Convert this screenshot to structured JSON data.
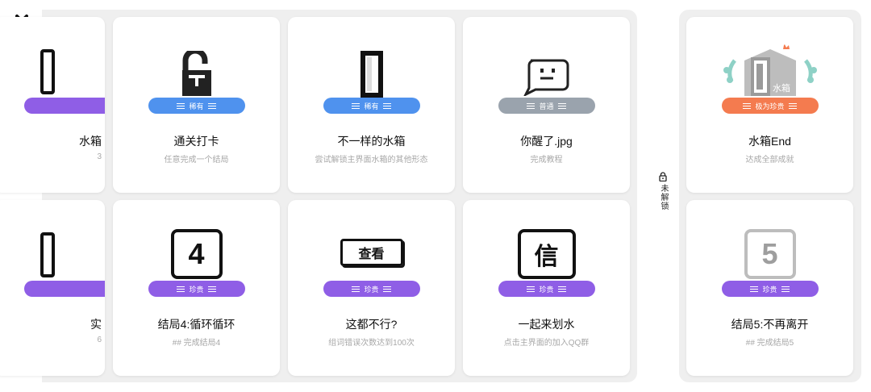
{
  "close_icon": "close-icon",
  "locked_section": {
    "label": "未解锁",
    "icon": "lock-icon"
  },
  "cards": {
    "r1c0": {
      "title": "水箱",
      "desc": "3",
      "badge": ""
    },
    "r1c1": {
      "title": "通关打卡",
      "desc": "任意完成一个结局",
      "badge": "稀有",
      "tier": "rare"
    },
    "r1c2": {
      "title": "不一样的水箱",
      "desc": "尝试解锁主界面水箱的其他形态",
      "badge": "稀有",
      "tier": "rare"
    },
    "r1c3": {
      "title": "你醒了.jpg",
      "desc": "完成教程",
      "badge": "普通",
      "tier": "common"
    },
    "r1side": {
      "title": "水箱End",
      "desc": "达成全部成就",
      "badge": "极为珍贵",
      "tier": "ultra"
    },
    "r2c0": {
      "title": "实",
      "desc": "6",
      "badge": ""
    },
    "r2c1": {
      "title": "结局4:循环循环",
      "desc": "## 完成结局4",
      "badge": "珍贵",
      "tier": "precious"
    },
    "r2c2": {
      "title": "这都不行?",
      "desc": "组词错误次数达到100次",
      "badge": "珍贵",
      "tier": "precious",
      "icon_text": "查看"
    },
    "r2c3": {
      "title": "一起来划水",
      "desc": "点击主界面的加入QQ群",
      "badge": "珍贵",
      "tier": "precious",
      "icon_text": "信"
    },
    "r2side": {
      "title": "结局5:不再离开",
      "desc": "## 完成结局5",
      "badge": "珍贵",
      "tier": "precious",
      "icon_text": "5"
    }
  },
  "icon_texts": {
    "r2c1": "4",
    "r1side_sign": "水箱"
  },
  "colors": {
    "rare": "#4f92ee",
    "common": "#9aa3ad",
    "precious": "#8f5ee6",
    "ultra": "#f47b4f",
    "panel": "#efefef"
  }
}
